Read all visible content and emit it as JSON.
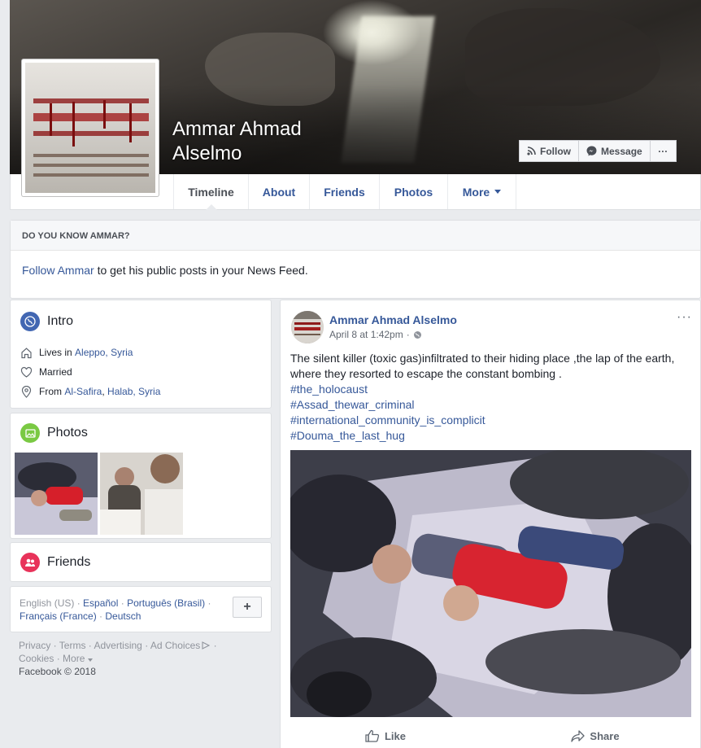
{
  "profile": {
    "name": "Ammar Ahmad\nAlselmo",
    "cover_alt": "Cover photo",
    "profile_pic_alt": "Profile picture"
  },
  "cover_actions": {
    "follow": "Follow",
    "message": "Message",
    "more": "···"
  },
  "tabs": [
    {
      "label": "Timeline",
      "active": true
    },
    {
      "label": "About"
    },
    {
      "label": "Friends"
    },
    {
      "label": "Photos"
    },
    {
      "label": "More"
    }
  ],
  "know": {
    "heading": "DO YOU KNOW AMMAR?",
    "follow_link": "Follow Ammar",
    "rest": " to get his public posts in your News Feed."
  },
  "intro": {
    "title": "Intro",
    "lives_prefix": "Lives in ",
    "lives_link": "Aleppo, Syria",
    "married": "Married",
    "from_prefix": "From ",
    "from_link1": "Al-Safira",
    "from_sep": ", ",
    "from_link2": "Halab, Syria"
  },
  "photos": {
    "title": "Photos"
  },
  "friends": {
    "title": "Friends"
  },
  "languages": {
    "items": [
      "English (US)",
      "Español",
      "Português (Brasil)",
      "Français (France)",
      "Deutsch"
    ],
    "sep": " · ",
    "add": "+"
  },
  "footer": {
    "privacy": "Privacy",
    "terms": "Terms",
    "advertising": "Advertising",
    "ad_choices": "Ad Choices",
    "cookies": "Cookies",
    "more": "More",
    "copyright": "Facebook © 2018"
  },
  "post": {
    "author": "Ammar Ahmad Alselmo",
    "date": "April 8 at 1:42pm",
    "dot": "·",
    "more": "···",
    "text": "The silent killer (toxic gas)infiltrated to their hiding place ,the lap of the earth, where they resorted to escape the constant bombing .",
    "hashtags": [
      "#the_holocaust",
      "#Assad_thewar_criminal",
      "#international_community_is_complicit",
      "#Douma_the_last_hug"
    ],
    "like": "Like",
    "share": "Share"
  },
  "colors": {
    "link": "#365899",
    "background": "#e9ebee",
    "intro_icon": "#4267b2",
    "photos_icon": "#7ac943",
    "friends_icon": "#e8335a"
  }
}
